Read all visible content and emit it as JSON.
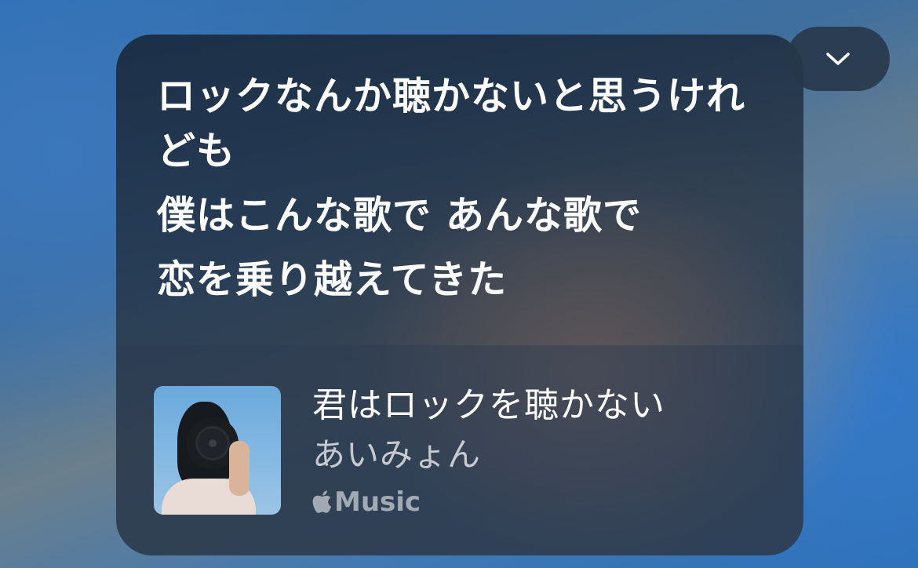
{
  "lyrics": {
    "lines": [
      "ロックなんか聴かないと思うけれども",
      "僕はこんな歌で あんな歌で",
      "恋を乗り越えてきた"
    ]
  },
  "now_playing": {
    "title": "君はロックを聴かない",
    "artist": "あいみょん",
    "service_label": "Music",
    "service_icon": "apple-logo-icon",
    "artwork_icon": "album-artwork"
  },
  "controls": {
    "collapse_icon": "chevron-down-icon"
  }
}
